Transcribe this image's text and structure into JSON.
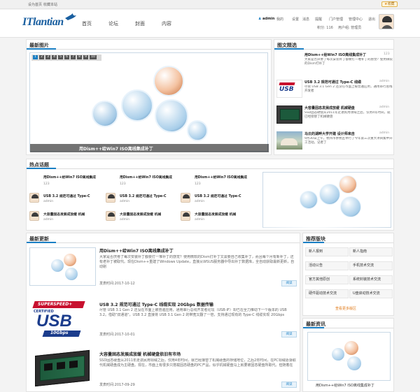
{
  "topbar": {
    "set_home": "设为首页",
    "favorite": "收藏本站",
    "top_badge": "收藏"
  },
  "header": {
    "logo": "ITlantian",
    "nav": [
      "首页",
      "论坛",
      "封面",
      "内容"
    ],
    "user": {
      "name": "admin",
      "links": [
        "我的",
        "设置",
        "消息",
        "提醒",
        "门户管理",
        "管理中心",
        "退出"
      ],
      "points": "积分: 116",
      "group": "用户组: 管理员"
    }
  },
  "latest_images": {
    "title": "最新图片",
    "pages": [
      "1",
      "2",
      "3",
      "4",
      "5",
      "6",
      "7",
      "8",
      "9",
      "10"
    ],
    "caption": "用Dism++给Win7 ISO离线集成补丁"
  },
  "featured": {
    "title": "图文精选",
    "items": [
      {
        "title": "用Dism++给Win7 ISO离线集成补丁",
        "meta": "123",
        "desc": "大家是否厌倦了每次安装补丁都要打一堆补丁的感觉？使用微软的Dism打补丁"
      },
      {
        "title": "USB 3.2 规范可通过 Type-C 线缆",
        "meta": "admin",
        "desc": "尽管 USB 3.1 Gen 2 还没在市面上被普遍应用，通用串行总线开发者"
      },
      {
        "title": "大容量固态发展成放缓 机械硬盘",
        "meta": "admin",
        "desc": "SSD固态硬盘从2011年走进民用领域之后，仅用4年时间，就已经接替了机械硬盘"
      },
      {
        "title": "马云的湖畔大学开建 设计师来自",
        "meta": "admin",
        "desc": "9月30日上午，杭州市余杭区举行了今年第三次重大项目集中开工活动。记者了"
      }
    ]
  },
  "hot_topics": {
    "title": "热点话题",
    "items": [
      {
        "title": "用Dism++给Win7 ISO离线集成",
        "meta": "123"
      },
      {
        "title": "用Dism++给Win7 ISO离线集成",
        "meta": "123"
      },
      {
        "title": "用Dism++给Win7 ISO离线集成",
        "meta": "123"
      },
      {
        "title": "USB 3.2 规范可通过 Type-C",
        "meta": "admin"
      },
      {
        "title": "USB 3.2 规范可通过 Type-C",
        "meta": "admin"
      },
      {
        "title": "USB 3.2 规范可通过 Type-C",
        "meta": "admin"
      },
      {
        "title": "大容量固态发展成放缓 机械",
        "meta": "admin"
      },
      {
        "title": "大容量固态发展成放缓 机械",
        "meta": "admin"
      },
      {
        "title": "大容量固态发展成放缓 机械",
        "meta": "admin"
      }
    ]
  },
  "latest_updates": {
    "title": "最新更新",
    "read_label": "阅读",
    "items": [
      {
        "title": "用Dism++给Win7 ISO离线集成补丁",
        "desc": "大家是否厌倦了每次安装补丁都要打一堆补丁的感觉？使用微软的Dism打补丁又需要自己收集补丁，而且每个月有新补丁，还有老补丁被取代。现在Dism++重建了Windows Update，直接从WSUS服务器中导出补丁数据库，全自动获取最新更新，自动剔",
        "date": "发表时间:2017-10-12"
      },
      {
        "title": "USB 3.2 规范可通过 Type-C 线缆实现 20Gbps 数据传输",
        "desc": "尽管 USB 3.1 Gen 2 还没在市面上被普遍应用，通用串行总线开发者论坛（USB-IF）却已在全力推动下一个版本的 USB 3.2。借助\"双通道\"，USB 3.2 直接将 USB 3.1 Gen 2 的带宽又翻了一倍，支持通过现有的 Type-C 线缆实现 20Gbps",
        "date": "发表时间:2017-10-01"
      },
      {
        "title": "大容量固态发展成放缓 机械硬盘依旧有市场",
        "desc": "SSD固态硬盘从2011年走进民用领域之后，仅用4年时间，就已经接替了机械硬盘的存储地位，之后2年时间，在PC领域逐渐取代机械硬盘成为主硬盘。现在，市面上有很多只搭载固态硬盘的PC产品，似乎机械硬盘马上就要被固态硬盘所取代。但随着在",
        "date": "发表时间:2017-09-29"
      }
    ]
  },
  "recommended": {
    "title": "推荐版块",
    "tags": [
      "新人报到",
      "新人指南",
      "活动公告",
      "手机技术交流",
      "官方其他原创",
      "系统封装技术交流",
      "硬件驱动技术交流",
      "U盘启动技术交流"
    ],
    "more": "查看更多版区"
  },
  "latest_info": {
    "title": "最新资讯",
    "caption": "用Dism++给Win7 ISO离线集成补丁"
  },
  "usb_logo": {
    "top": "SUPERSPEED+",
    "main": "USB",
    "sub": "10Gbps",
    "cert": "CERTIFIED"
  },
  "colors": {
    "accent": "#1a7fc4",
    "read_btn": "#e8f3fb"
  }
}
